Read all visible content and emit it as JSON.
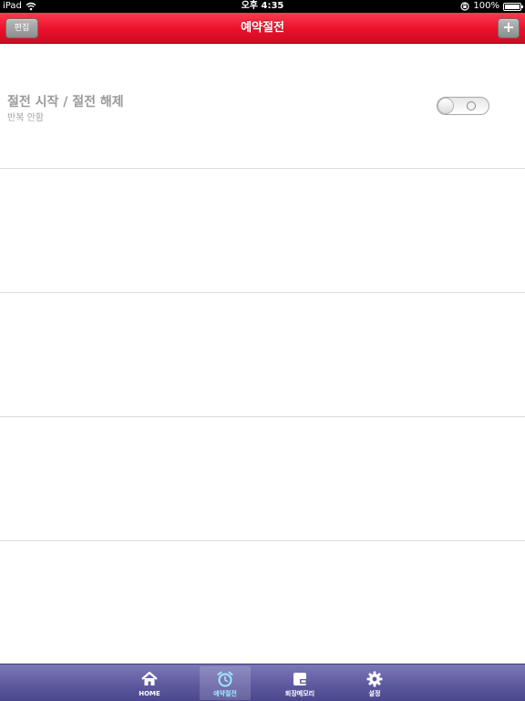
{
  "status_bar": {
    "device": "iPad",
    "time": "오후 4:35",
    "battery": "100%"
  },
  "nav": {
    "title": "예약절전",
    "edit_label": "편집",
    "add_label": "+"
  },
  "rows": [
    {
      "title": "절전 시작 / 절전 해제",
      "subtitle": "반복 안함",
      "toggle_on": false
    }
  ],
  "tabs": [
    {
      "label": "HOME",
      "icon": "home-icon",
      "active": false
    },
    {
      "label": "예약절전",
      "icon": "alarm-clock-icon",
      "active": true
    },
    {
      "label": "퇴장메모리",
      "icon": "memo-icon",
      "active": false
    },
    {
      "label": "설정",
      "icon": "gear-icon",
      "active": false
    }
  ],
  "colors": {
    "nav_red": "#e8112a",
    "tab_purple": "#5e5aa0",
    "tab_active_label": "#9fe8ff"
  }
}
